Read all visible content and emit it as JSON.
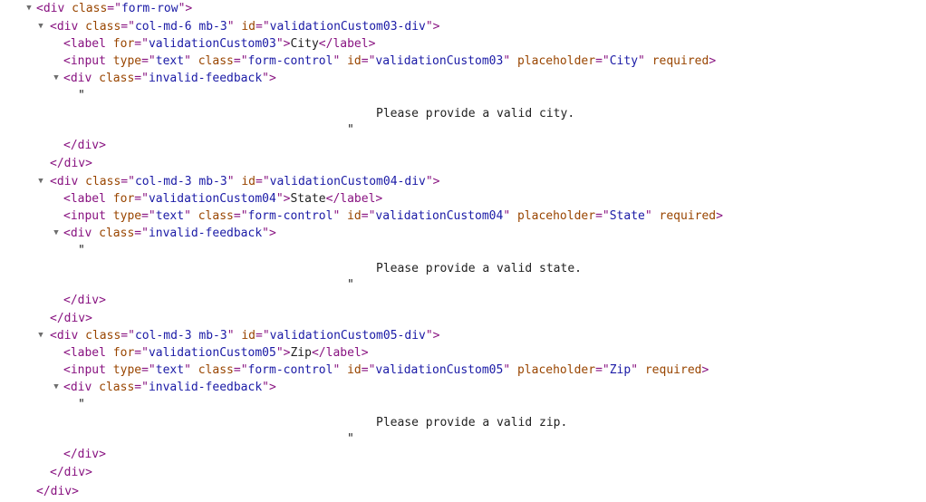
{
  "expand_arrow": "▼",
  "form_row": {
    "open_tag": "div",
    "class_value": "form-row",
    "close_tag": "div"
  },
  "groups": [
    {
      "div_class": "col-md-6 mb-3",
      "div_id": "validationCustom03-div",
      "label_for": "validationCustom03",
      "label_text": "City",
      "input_type": "text",
      "input_class": "form-control",
      "input_id": "validationCustom03",
      "input_placeholder": "City",
      "input_required": "required",
      "feedback_class": "invalid-feedback",
      "feedback_text": "Please provide a valid city."
    },
    {
      "div_class": "col-md-3 mb-3",
      "div_id": "validationCustom04-div",
      "label_for": "validationCustom04",
      "label_text": "State",
      "input_type": "text",
      "input_class": "form-control",
      "input_id": "validationCustom04",
      "input_placeholder": "State",
      "input_required": "required",
      "feedback_class": "invalid-feedback",
      "feedback_text": "Please provide a valid state."
    },
    {
      "div_class": "col-md-3 mb-3",
      "div_id": "validationCustom05-div",
      "label_for": "validationCustom05",
      "label_text": "Zip",
      "input_type": "text",
      "input_class": "form-control",
      "input_id": "validationCustom05",
      "input_placeholder": "Zip",
      "input_required": "required",
      "feedback_class": "invalid-feedback",
      "feedback_text": "Please provide a valid zip."
    }
  ],
  "syntax_colors": {
    "tag": "#881280",
    "attribute": "#994500",
    "value": "#1a1aa6",
    "text": "#222222"
  }
}
